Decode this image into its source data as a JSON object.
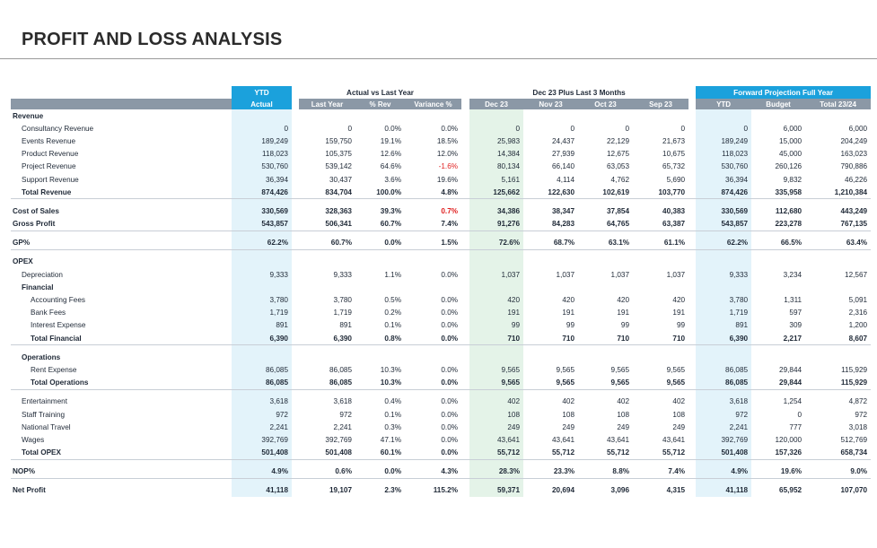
{
  "title": "PROFIT AND LOSS ANALYSIS",
  "colors": {
    "accent": "#1ba1dc",
    "subheader_grey": "#8b98a6",
    "ytd_band": "#e3f3fa",
    "dec_band": "#e4f3e8",
    "negative": "#e02020"
  },
  "groups": {
    "ytd": "YTD",
    "actual_vs_last_year": "Actual vs Last Year",
    "dec_plus_3": "Dec 23 Plus Last 3 Months",
    "forward": "Forward Projection Full Year"
  },
  "columns": [
    "Actual",
    "Last Year",
    "% Rev",
    "Variance %",
    "Dec 23",
    "Nov 23",
    "Oct 23",
    "Sep 23",
    "YTD",
    "Budget",
    "Total 23/24"
  ],
  "rows": [
    {
      "label": "Revenue",
      "style": "section",
      "values": [
        "",
        "",
        "",
        "",
        "",
        "",
        "",
        "",
        "",
        "",
        ""
      ]
    },
    {
      "label": "Consultancy Revenue",
      "style": "l1",
      "values": [
        "0",
        "0",
        "0.0%",
        "0.0%",
        "0",
        "0",
        "0",
        "0",
        "0",
        "6,000",
        "6,000"
      ]
    },
    {
      "label": "Events Revenue",
      "style": "l1",
      "values": [
        "189,249",
        "159,750",
        "19.1%",
        "18.5%",
        "25,983",
        "24,437",
        "22,129",
        "21,673",
        "189,249",
        "15,000",
        "204,249"
      ]
    },
    {
      "label": "Product Revenue",
      "style": "l1",
      "values": [
        "118,023",
        "105,375",
        "12.6%",
        "12.0%",
        "14,384",
        "27,939",
        "12,675",
        "10,675",
        "118,023",
        "45,000",
        "163,023"
      ]
    },
    {
      "label": "Project Revenue",
      "style": "l1",
      "values": [
        "530,760",
        "539,142",
        "64.6%",
        "-1.6%",
        "80,134",
        "66,140",
        "63,053",
        "65,732",
        "530,760",
        "260,126",
        "790,886"
      ],
      "neg": [
        3
      ]
    },
    {
      "label": "Support Revenue",
      "style": "l1",
      "values": [
        "36,394",
        "30,437",
        "3.6%",
        "19.6%",
        "5,161",
        "4,114",
        "4,762",
        "5,690",
        "36,394",
        "9,832",
        "46,226"
      ]
    },
    {
      "label": "Total Revenue",
      "style": "bold-l1",
      "values": [
        "874,426",
        "834,704",
        "100.0%",
        "4.8%",
        "125,662",
        "122,630",
        "102,619",
        "103,770",
        "874,426",
        "335,958",
        "1,210,384"
      ]
    },
    {
      "label": "Cost of Sales",
      "style": "bold",
      "values": [
        "330,569",
        "328,363",
        "39.3%",
        "0.7%",
        "34,386",
        "38,347",
        "37,854",
        "40,383",
        "330,569",
        "112,680",
        "443,249"
      ],
      "neg": [
        3
      ]
    },
    {
      "label": "Gross Profit",
      "style": "bold",
      "values": [
        "543,857",
        "506,341",
        "60.7%",
        "7.4%",
        "91,276",
        "84,283",
        "64,765",
        "63,387",
        "543,857",
        "223,278",
        "767,135"
      ]
    },
    {
      "label": "GP%",
      "style": "bold",
      "values": [
        "62.2%",
        "60.7%",
        "0.0%",
        "1.5%",
        "72.6%",
        "68.7%",
        "63.1%",
        "61.1%",
        "62.2%",
        "66.5%",
        "63.4%"
      ]
    },
    {
      "label": "OPEX",
      "style": "section",
      "values": [
        "",
        "",
        "",
        "",
        "",
        "",
        "",
        "",
        "",
        "",
        ""
      ]
    },
    {
      "label": "Depreciation",
      "style": "l1",
      "values": [
        "9,333",
        "9,333",
        "1.1%",
        "0.0%",
        "1,037",
        "1,037",
        "1,037",
        "1,037",
        "9,333",
        "3,234",
        "12,567"
      ]
    },
    {
      "label": "Financial",
      "style": "section-l1",
      "values": [
        "",
        "",
        "",
        "",
        "",
        "",
        "",
        "",
        "",
        "",
        ""
      ]
    },
    {
      "label": "Accounting Fees",
      "style": "l2",
      "values": [
        "3,780",
        "3,780",
        "0.5%",
        "0.0%",
        "420",
        "420",
        "420",
        "420",
        "3,780",
        "1,311",
        "5,091"
      ]
    },
    {
      "label": "Bank Fees",
      "style": "l2",
      "values": [
        "1,719",
        "1,719",
        "0.2%",
        "0.0%",
        "191",
        "191",
        "191",
        "191",
        "1,719",
        "597",
        "2,316"
      ]
    },
    {
      "label": "Interest Expense",
      "style": "l2",
      "values": [
        "891",
        "891",
        "0.1%",
        "0.0%",
        "99",
        "99",
        "99",
        "99",
        "891",
        "309",
        "1,200"
      ]
    },
    {
      "label": "Total Financial",
      "style": "bold-l2",
      "values": [
        "6,390",
        "6,390",
        "0.8%",
        "0.0%",
        "710",
        "710",
        "710",
        "710",
        "6,390",
        "2,217",
        "8,607"
      ]
    },
    {
      "label": "Operations",
      "style": "section-l1",
      "values": [
        "",
        "",
        "",
        "",
        "",
        "",
        "",
        "",
        "",
        "",
        ""
      ]
    },
    {
      "label": "Rent Expense",
      "style": "l2",
      "values": [
        "86,085",
        "86,085",
        "10.3%",
        "0.0%",
        "9,565",
        "9,565",
        "9,565",
        "9,565",
        "86,085",
        "29,844",
        "115,929"
      ]
    },
    {
      "label": "Total Operations",
      "style": "bold-l2",
      "values": [
        "86,085",
        "86,085",
        "10.3%",
        "0.0%",
        "9,565",
        "9,565",
        "9,565",
        "9,565",
        "86,085",
        "29,844",
        "115,929"
      ]
    },
    {
      "label": "Entertainment",
      "style": "l1",
      "values": [
        "3,618",
        "3,618",
        "0.4%",
        "0.0%",
        "402",
        "402",
        "402",
        "402",
        "3,618",
        "1,254",
        "4,872"
      ]
    },
    {
      "label": "Staff Training",
      "style": "l1",
      "values": [
        "972",
        "972",
        "0.1%",
        "0.0%",
        "108",
        "108",
        "108",
        "108",
        "972",
        "0",
        "972"
      ]
    },
    {
      "label": "National Travel",
      "style": "l1",
      "values": [
        "2,241",
        "2,241",
        "0.3%",
        "0.0%",
        "249",
        "249",
        "249",
        "249",
        "2,241",
        "777",
        "3,018"
      ]
    },
    {
      "label": "Wages",
      "style": "l1",
      "values": [
        "392,769",
        "392,769",
        "47.1%",
        "0.0%",
        "43,641",
        "43,641",
        "43,641",
        "43,641",
        "392,769",
        "120,000",
        "512,769"
      ]
    },
    {
      "label": "Total OPEX",
      "style": "bold-l1",
      "values": [
        "501,408",
        "501,408",
        "60.1%",
        "0.0%",
        "55,712",
        "55,712",
        "55,712",
        "55,712",
        "501,408",
        "157,326",
        "658,734"
      ]
    },
    {
      "label": "NOP%",
      "style": "bold",
      "values": [
        "4.9%",
        "0.6%",
        "0.0%",
        "4.3%",
        "28.3%",
        "23.3%",
        "8.8%",
        "7.4%",
        "4.9%",
        "19.6%",
        "9.0%"
      ]
    },
    {
      "label": "Net Profit",
      "style": "bold",
      "values": [
        "41,118",
        "19,107",
        "2.3%",
        "115.2%",
        "59,371",
        "20,694",
        "3,096",
        "4,315",
        "41,118",
        "65,952",
        "107,070"
      ]
    }
  ]
}
